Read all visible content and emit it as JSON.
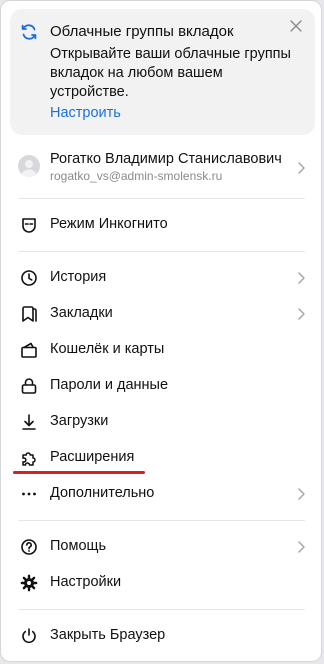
{
  "sync_card": {
    "title": "Облачные группы вкладок",
    "description": "Открывайте ваши облачные группы вкладок на любом вашем устройстве.",
    "link": "Настроить"
  },
  "profile": {
    "name": "Рогатко Владимир Станиславович",
    "email": "rogatko_vs@admin-smolensk.ru"
  },
  "menu": {
    "incognito": "Режим Инкогнито",
    "history": "История",
    "bookmarks": "Закладки",
    "wallet": "Кошелёк и карты",
    "passwords": "Пароли и данные",
    "downloads": "Загрузки",
    "extensions": "Расширения",
    "more": "Дополнительно",
    "help": "Помощь",
    "settings": "Настройки",
    "close_browser": "Закрыть Браузер"
  },
  "colors": {
    "accent": "#1a6fdd",
    "highlight": "#d81f26"
  },
  "icons": {
    "sync": "sync-icon",
    "close": "close-icon",
    "incognito": "mask-icon",
    "history": "clock-icon",
    "bookmarks": "bookmark-icon",
    "wallet": "wallet-icon",
    "passwords": "key-icon",
    "downloads": "download-icon",
    "extensions": "puzzle-icon",
    "more": "more-dots-icon",
    "help": "help-icon",
    "settings": "gear-icon",
    "close_browser": "power-icon"
  }
}
